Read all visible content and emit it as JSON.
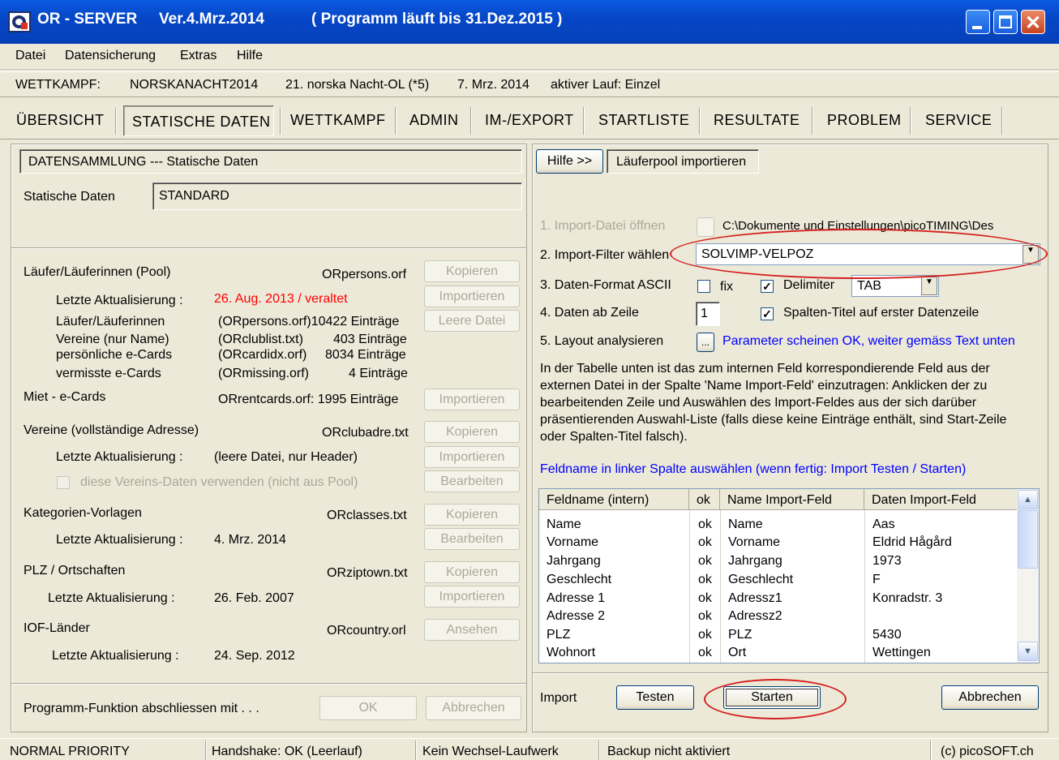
{
  "window": {
    "title_app": "OR - SERVER",
    "title_version": "Ver.4.Mrz.2014",
    "title_expiry": "( Programm läuft bis 31.Dez.2015 )"
  },
  "menu": [
    "Datei",
    "Datensicherung",
    "Extras",
    "Hilfe"
  ],
  "info": {
    "label": "WETTKAMPF:",
    "code": "NORSKANACHT2014",
    "name": "21. norska Nacht-OL (*5)",
    "date": "7. Mrz. 2014",
    "run": "aktiver Lauf: Einzel"
  },
  "tabs": [
    "ÜBERSICHT",
    "STATISCHE DATEN",
    "WETTKAMPF",
    "ADMIN",
    "IM-/EXPORT",
    "STARTLISTE",
    "RESULTATE",
    "PROBLEM",
    "SERVICE"
  ],
  "left": {
    "header": "DATENSAMMLUNG --- Statische Daten",
    "static_label": "Statische Daten",
    "static_value": "STANDARD",
    "pool_title": "Läufer/Läuferinnen (Pool)",
    "pool_file": "ORpersons.orf",
    "last_update_label": "Letzte Aktualisierung :",
    "pool_update": "26. Aug. 2013 / veraltet",
    "runners_label": "Läufer/Läuferinnen",
    "runners_value": "(ORpersons.orf)10422 Einträge",
    "clubs_label": "Vereine (nur Name)",
    "clubs_value": "(ORclublist.txt)",
    "clubs_count": "403 Einträge",
    "ecards_label": "persönliche e-Cards",
    "ecards_value": "(ORcardidx.orf)",
    "ecards_count": "8034 Einträge",
    "missing_label": "vermisste e-Cards",
    "missing_value": "(ORmissing.orf)",
    "missing_count": "4 Einträge",
    "rent_title": "Miet - e-Cards",
    "rent_value": "ORrentcards.orf: 1995 Einträge",
    "club_title": "Vereine (vollständige Adresse)",
    "club_file": "ORclubadre.txt",
    "club_update": "(leere Datei, nur Header)",
    "club_use": "diese Vereins-Daten verwenden (nicht aus Pool)",
    "cat_title": "Kategorien-Vorlagen",
    "cat_file": "ORclasses.txt",
    "cat_update": "4. Mrz. 2014",
    "plz_title": "PLZ / Ortschaften",
    "plz_file": "ORziptown.txt",
    "plz_update_label": "Letzte Aktualisierung :",
    "plz_update": "26. Feb. 2007",
    "iof_title": "IOF-Länder",
    "iof_file": "ORcountry.orl",
    "iof_update_label": "Letzte Aktualisierung :",
    "iof_update": "24. Sep. 2012",
    "footer": "Programm-Funktion abschliessen mit . . .",
    "btn_copy": "Kopieren",
    "btn_import": "Importieren",
    "btn_empty": "Leere Datei",
    "btn_edit": "Bearbeiten",
    "btn_view": "Ansehen",
    "btn_ok": "OK",
    "btn_cancel": "Abbrechen"
  },
  "right": {
    "help_btn": "Hilfe >>",
    "title": "Läuferpool importieren",
    "step1": "1. Import-Datei öffnen",
    "step1_path": "C:\\Dokumente und Einstellungen\\picoTIMING\\Des",
    "step2": "2. Import-Filter wählen",
    "filter": "SOLVIMP-VELPOZ",
    "step3": "3. Daten-Format ASCII",
    "fix": "fix",
    "delimiter": "Delimiter",
    "delim_value": "TAB",
    "step4": "4. Daten ab Zeile",
    "start_row": "1",
    "col_titles": "Spalten-Titel auf erster Datenzeile",
    "step5": "5. Layout analysieren",
    "step5_btn": "...",
    "step5_status": "Parameter scheinen OK, weiter gemäss Text unten",
    "instr1": "In der Tabelle unten ist das zum internen Feld korrespondierende Feld aus der",
    "instr2": "externen Datei in der Spalte 'Name Import-Feld' einzutragen: Anklicken der zu",
    "instr3": "bearbeitenden Zeile und Auswählen des Import-Feldes aus der sich darüber",
    "instr4": "präsentierenden Auswahl-Liste (falls diese keine Einträge enthält, sind Start-Zeile",
    "instr5": "oder Spalten-Titel falsch).",
    "hint": "Feldname in linker Spalte auswählen (wenn fertig: Import Testen / Starten)",
    "columns": [
      "Feldname (intern)",
      "ok",
      "Name Import-Feld",
      "Daten Import-Feld"
    ],
    "rows": [
      [
        "Name",
        "ok",
        "Name",
        "Aas"
      ],
      [
        "Vorname",
        "ok",
        "Vorname",
        "Eldrid Hågård"
      ],
      [
        "Jahrgang",
        "ok",
        "Jahrgang",
        "1973"
      ],
      [
        "Geschlecht",
        "ok",
        "Geschlecht",
        "F"
      ],
      [
        "Adresse 1",
        "ok",
        "Adressz1",
        "Konradstr. 3"
      ],
      [
        "Adresse 2",
        "ok",
        "Adressz2",
        ""
      ],
      [
        "PLZ",
        "ok",
        "PLZ",
        "5430"
      ],
      [
        "Wohnort",
        "ok",
        "Ort",
        "Wettingen"
      ]
    ],
    "import_label": "Import",
    "btn_test": "Testen",
    "btn_start": "Starten",
    "btn_cancel": "Abbrechen"
  },
  "status": [
    "NORMAL PRIORITY",
    "Handshake: OK (Leerlauf)",
    "Kein Wechsel-Laufwerk",
    "Backup nicht aktiviert",
    "(c) picoSOFT.ch"
  ],
  "icons": {
    "app": "or-server-icon",
    "check": "check-icon",
    "dropdown": "chevron-down-icon"
  },
  "colors": {
    "titlebar": "#0647c8",
    "warning": "#ff0000",
    "info": "#0000ff",
    "highlight": "#d42020"
  }
}
